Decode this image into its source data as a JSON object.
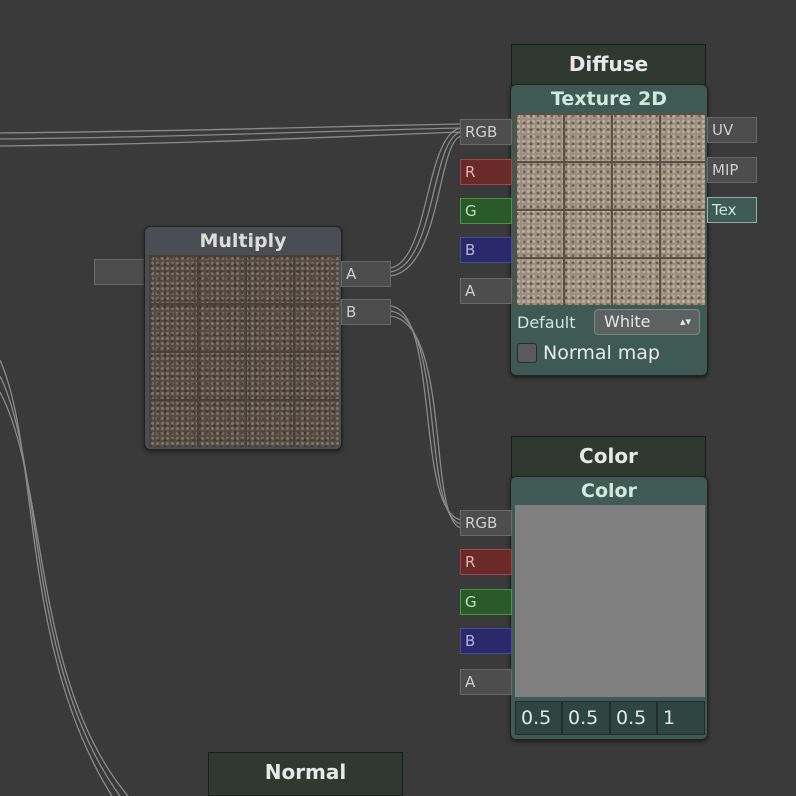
{
  "nodes": {
    "diffuse": {
      "header": "Diffuse",
      "title": "Texture 2D",
      "inputs": [
        "RGB",
        "R",
        "G",
        "B",
        "A"
      ],
      "outputs": [
        "UV",
        "MIP",
        "Tex"
      ],
      "default_label": "Default",
      "default_value": "White",
      "normal_map_label": "Normal map",
      "normal_map_checked": false
    },
    "multiply": {
      "title": "Multiply",
      "inputs": [
        "A",
        "B"
      ]
    },
    "color": {
      "header": "Color",
      "title": "Color",
      "inputs": [
        "RGB",
        "R",
        "G",
        "B",
        "A"
      ],
      "values": [
        "0.5",
        "0.5",
        "0.5",
        "1"
      ],
      "swatch_color": "#808080"
    },
    "normal": {
      "header": "Normal"
    }
  },
  "colors": {
    "canvas": "#3a3a3a",
    "node_panel": "#3f5a52",
    "node_header": "#2f3831",
    "wire": "#8a8a8a",
    "port_red": "#6a2a2a",
    "port_green": "#2a5a2a",
    "port_blue": "#2a2a6a"
  }
}
